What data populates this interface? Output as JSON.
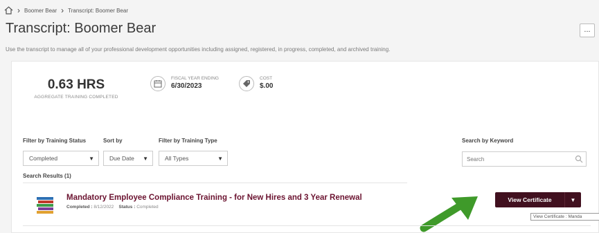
{
  "breadcrumb": {
    "items": [
      "Boomer Bear",
      "Transcript: Boomer Bear"
    ]
  },
  "page": {
    "title": "Transcript: Boomer Bear",
    "description": "Use the transcript to manage all of your professional development opportunities including assigned, registered, in progress, completed, and archived training.",
    "more_label": "..."
  },
  "stats": {
    "hours_value": "0.63 HRS",
    "hours_label": "AGGREGATE TRAINING COMPLETED",
    "fiscal_label": "FISCAL YEAR ENDING",
    "fiscal_value": "6/30/2023",
    "cost_label": "COST",
    "cost_value": "$.00"
  },
  "filters": {
    "status_label": "Filter by Training Status",
    "status_value": "Completed",
    "sort_label": "Sort by",
    "sort_value": "Due Date",
    "type_label": "Filter by Training Type",
    "type_value": "All Types",
    "search_label": "Search by Keyword",
    "search_placeholder": "Search"
  },
  "results": {
    "label": "Search Results (1)",
    "items": [
      {
        "title": "Mandatory Employee Compliance Training - for New Hires and 3 Year Renewal",
        "completed_label": "Completed :",
        "completed_value": "8/12/2022",
        "status_label": "Status :",
        "status_value": "Completed",
        "action_label": "View Certificate"
      }
    ]
  },
  "tooltip": "View Certificate : Manda",
  "colors": {
    "accent": "#41101f",
    "title": "#6b1330",
    "arrow": "#3f9a2a"
  },
  "icons": {
    "home": "home-icon",
    "calendar": "calendar-icon",
    "cost": "tag-icon",
    "search": "search-icon",
    "training": "books-icon"
  }
}
